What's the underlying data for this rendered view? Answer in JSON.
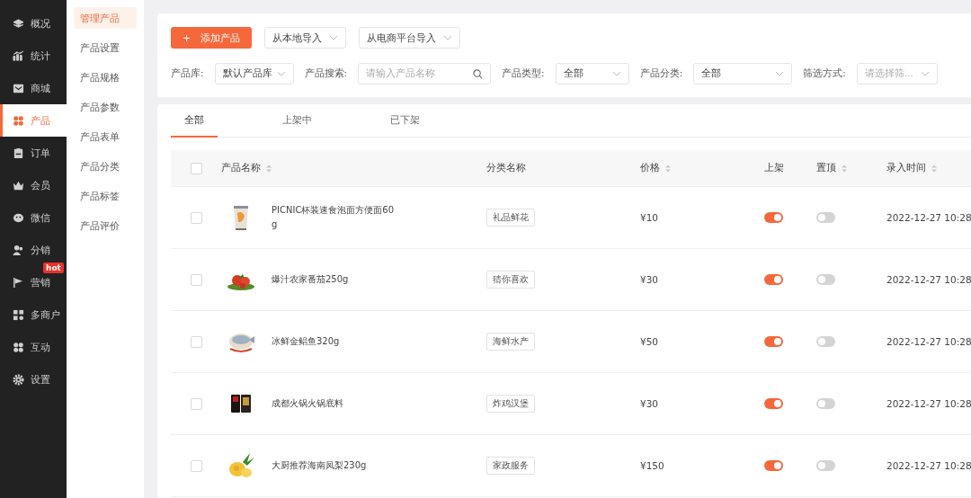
{
  "nav": [
    {
      "label": "概况",
      "selected": false
    },
    {
      "label": "统计",
      "selected": false
    },
    {
      "label": "商城",
      "selected": false
    },
    {
      "label": "产品",
      "selected": true
    },
    {
      "label": "订单",
      "selected": false
    },
    {
      "label": "会员",
      "selected": false
    },
    {
      "label": "微信",
      "selected": false
    },
    {
      "label": "分销",
      "selected": false
    },
    {
      "label": "营销",
      "selected": false,
      "badge": "hot"
    },
    {
      "label": "多商户",
      "selected": false
    },
    {
      "label": "互动",
      "selected": false
    },
    {
      "label": "设置",
      "selected": false
    }
  ],
  "submenu": [
    {
      "label": "管理产品",
      "selected": true
    },
    {
      "label": "产品设置",
      "selected": false
    },
    {
      "label": "产品规格",
      "selected": false
    },
    {
      "label": "产品参数",
      "selected": false
    },
    {
      "label": "产品表单",
      "selected": false
    },
    {
      "label": "产品分类",
      "selected": false
    },
    {
      "label": "产品标签",
      "selected": false
    },
    {
      "label": "产品评价",
      "selected": false
    }
  ],
  "actions": {
    "add_button": "添加产品",
    "add_icon": "+",
    "imports": [
      "从本地导入",
      "从电商平台导入"
    ]
  },
  "filters": [
    {
      "kind": "select",
      "label": "产品库:",
      "value": "默认产品库"
    },
    {
      "kind": "search",
      "label": "产品搜索:",
      "placeholder": "请输入产品名称"
    },
    {
      "kind": "select",
      "label": "产品类型:",
      "value": "全部"
    },
    {
      "kind": "select",
      "label": "产品分类:",
      "value": "全部"
    },
    {
      "kind": "select",
      "label": "筛选方式:",
      "placeholder": "请选择筛..."
    }
  ],
  "tabs": [
    {
      "label": "全部",
      "selected": true
    },
    {
      "label": "上架中",
      "selected": false
    },
    {
      "label": "已下架",
      "selected": false
    }
  ],
  "table": {
    "columns": [
      {
        "label": "产品名称",
        "sortable": true
      },
      {
        "label": "分类名称",
        "sortable": false
      },
      {
        "label": "价格",
        "sortable": true
      },
      {
        "label": "上架",
        "sortable": false
      },
      {
        "label": "置顶",
        "sortable": true
      },
      {
        "label": "录入时间",
        "sortable": true
      }
    ],
    "header_checked": false,
    "rows": [
      {
        "checked": false,
        "name": "PICNIC杯装速食泡面方便面60g",
        "category": "礼品鲜花",
        "price": "¥10",
        "on_shelf": true,
        "pinned": false,
        "time": "2022-12-27 10:28"
      },
      {
        "checked": false,
        "name": "爆汁农家番茄250g",
        "category": "猜你喜欢",
        "price": "¥30",
        "on_shelf": true,
        "pinned": false,
        "time": "2022-12-27 10:28"
      },
      {
        "checked": false,
        "name": "冰鲜金鲳鱼320g",
        "category": "海鲜水产",
        "price": "¥50",
        "on_shelf": true,
        "pinned": false,
        "time": "2022-12-27 10:28"
      },
      {
        "checked": false,
        "name": "成都火锅火锅底料",
        "category": "炸鸡汉堡",
        "price": "¥30",
        "on_shelf": true,
        "pinned": false,
        "time": "2022-12-27 10:28"
      },
      {
        "checked": false,
        "name": "大厨推荐海南凤梨230g",
        "category": "家政服务",
        "price": "¥150",
        "on_shelf": true,
        "pinned": false,
        "time": "2022-12-27 10:28"
      }
    ]
  }
}
